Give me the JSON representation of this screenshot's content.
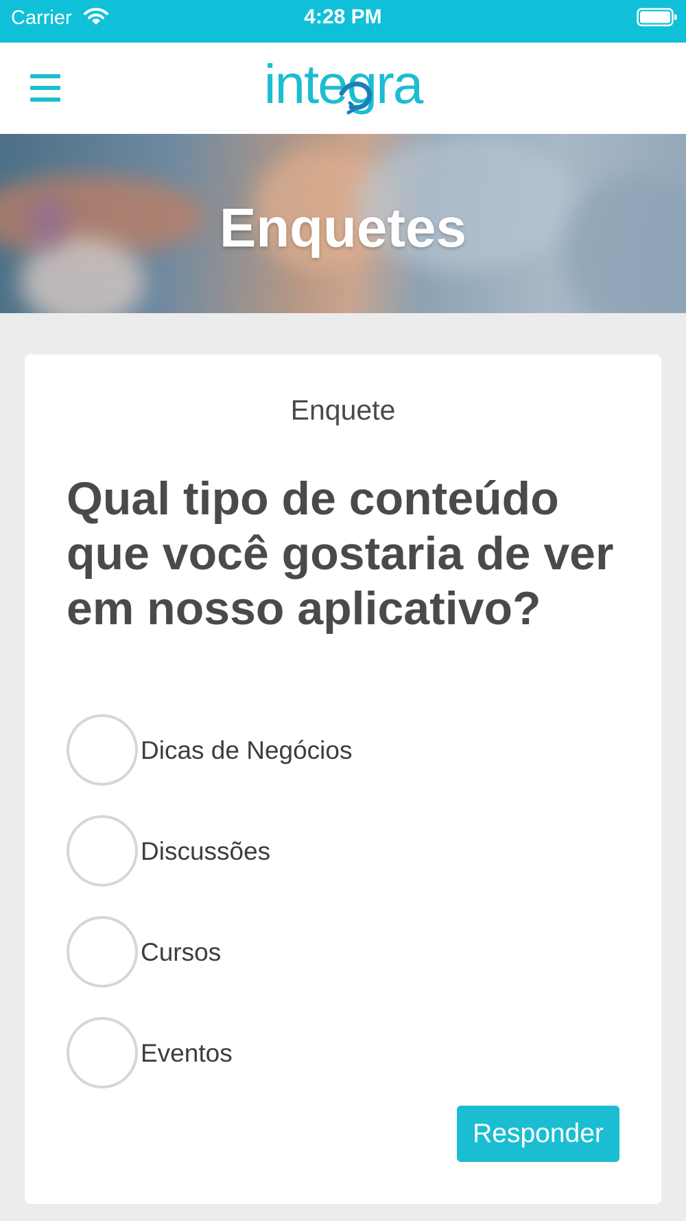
{
  "status_bar": {
    "carrier": "Carrier",
    "time": "4:28 PM",
    "background_color": "#10c0d8",
    "icons": [
      "wifi-icon",
      "battery-icon"
    ]
  },
  "nav_bar": {
    "menu_icon": "hamburger-menu-icon",
    "logo_text": "integra",
    "accent_color": "#1bbdd2",
    "logo_secondary_color": "#1a7fb8"
  },
  "hero": {
    "title": "Enquetes"
  },
  "poll": {
    "label": "Enquete",
    "question": "Qual tipo de conteúdo que você gostaria de ver em nosso aplicativo?",
    "options": [
      {
        "label": "Dicas de Negócios",
        "selected": false
      },
      {
        "label": "Discussões",
        "selected": false
      },
      {
        "label": "Cursos",
        "selected": false
      },
      {
        "label": "Eventos",
        "selected": false
      }
    ],
    "submit_label": "Responder"
  }
}
